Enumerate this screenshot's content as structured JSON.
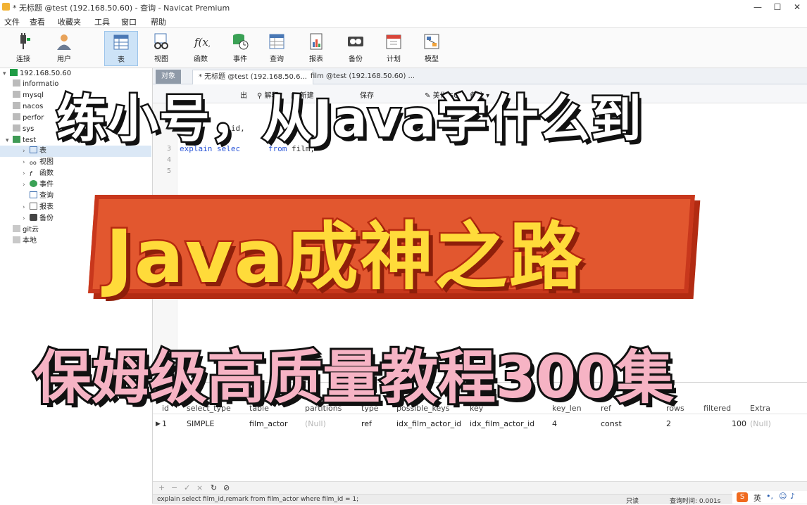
{
  "window": {
    "title": "* 无标题 @test (192.168.50.60) - 查询 - Navicat Premium"
  },
  "menu": [
    "文件",
    "查看",
    "收藏夹",
    "工具",
    "窗口",
    "帮助"
  ],
  "toolbar": [
    {
      "label": "连接",
      "icon": "plug-icon"
    },
    {
      "label": "用户",
      "icon": "user-icon"
    },
    {
      "label": "表",
      "icon": "table-icon",
      "active": true
    },
    {
      "label": "视图",
      "icon": "glasses-icon"
    },
    {
      "label": "函数",
      "icon": "function-icon"
    },
    {
      "label": "事件",
      "icon": "event-icon"
    },
    {
      "label": "查询",
      "icon": "query-icon"
    },
    {
      "label": "报表",
      "icon": "report-icon"
    },
    {
      "label": "备份",
      "icon": "backup-icon"
    },
    {
      "label": "计划",
      "icon": "calendar-icon"
    },
    {
      "label": "模型",
      "icon": "model-icon"
    }
  ],
  "nav": {
    "connection": "192.168.50.60",
    "databases": [
      "informatio",
      "mysql",
      "nacos",
      "perfor",
      "sys",
      "test"
    ],
    "test_children": [
      "表",
      "视图",
      "函数",
      "事件",
      "查询",
      "报表",
      "备份"
    ],
    "other": [
      "git云",
      "本地"
    ]
  },
  "tabs": [
    {
      "label": "对象"
    },
    {
      "label": "* 无标题 @test (192.168.50.6..."
    },
    {
      "label": "film @test (192.168.50.60) ..."
    }
  ],
  "query_toolbar": [
    "出",
    "解释",
    "新建",
    "保存",
    "美化 SQL",
    "备注"
  ],
  "editor": {
    "line_numbers": [
      "2",
      "3",
      "4",
      "5"
    ],
    "line2": "selec   im_id,",
    "line3_keyword1": "explain",
    "line3_keyword2": "selec",
    "line3_keyword3": "from",
    "line3_rest": "film;"
  },
  "result": {
    "columns": [
      "id",
      "select_type",
      "table",
      "partitions",
      "type",
      "possible_keys",
      "key",
      "key_len",
      "ref",
      "rows",
      "filtered",
      "Extra"
    ],
    "row": [
      "1",
      "SIMPLE",
      "film_actor",
      "(Null)",
      "ref",
      "idx_film_actor_id",
      "idx_film_actor_id",
      "4",
      "const",
      "2",
      "100",
      "(Null)"
    ]
  },
  "navbar": [
    "+",
    "−",
    "✓",
    "×",
    "↻",
    "⊘"
  ],
  "status": {
    "sql": "explain select film_id,remark from film_actor where film_id = 1;",
    "mode": "只读",
    "time": "查询时间: 0.001s",
    "ime": "英"
  },
  "overlay": {
    "line1": "练小号，从Java学什么到",
    "line2": "Java成神之路",
    "line3": "保姆级高质量教程300集"
  },
  "colors": {
    "banner_bg": "#e2572f",
    "banner_text": "#ffdb3a",
    "pink_text": "#f6b3c4",
    "selection": "#cde3f7"
  }
}
